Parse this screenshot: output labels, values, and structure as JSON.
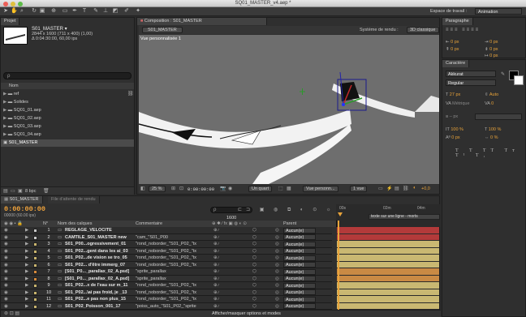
{
  "window": {
    "title": "SQ01_MASTER_v4.aep *"
  },
  "toolbar": {
    "workspace_label": "Espace de travail :",
    "workspace_value": "Animation"
  },
  "project": {
    "tab": "Projet",
    "item_name": "S01_MASTER ▾",
    "item_info1": "2844 x 1600  (711 x 400) (1,00)",
    "item_info2": "Δ 0:04:30:00, 60,00 ips",
    "search_placeholder": "ρ",
    "col_name": "Nom",
    "items": [
      "ref",
      "Solides",
      "SQ01_01.aep",
      "SQ01_02.aep",
      "SQ01_03.aep",
      "SQ01_04.aep",
      "S01_MASTER"
    ],
    "bpc": "8 bpc"
  },
  "composition": {
    "tab": "Composition : S01_MASTER",
    "comp_btn": "S01_MASTER",
    "renderer": "Système de rendu :",
    "renderer_value": "3D classique",
    "view_label": "Vue personnalisée 1",
    "zoom": "25 %",
    "time": "0:00:00:00",
    "quality": "Un quart",
    "view_select": "Vue personn...",
    "views": "1 vue",
    "exposure": "+0,0"
  },
  "paragraph": {
    "tab": "Paragraphe",
    "indent_values": [
      "0 px",
      "0 px",
      "0 px",
      "0 px",
      "0 px"
    ]
  },
  "character": {
    "tab": "Caractère",
    "font": "Akkurat",
    "style": "Regular",
    "size": "27 px",
    "leading": "Auto",
    "kerning": "Métrique",
    "tracking": "0",
    "stroke": "– px",
    "vscale": "100 %",
    "hscale": "100 %",
    "baseline": "0 px",
    "tsume": "0 %"
  },
  "timeline": {
    "tab": "S01_MASTER",
    "render_tab": "File d'attente de rendu",
    "timecode": "0:00:00:00",
    "frames": "00000 (60.00 ips)",
    "search_placeholder": "ρ",
    "frame_box": "1600",
    "col_num": "N°",
    "col_name": "Nom des calques",
    "col_comment": "Commentaire",
    "col_parent": "Parent",
    "ruler": [
      "00s",
      "02m",
      "04m"
    ],
    "marker_text": "texte sur une ligne - morts",
    "bottom_label": "Afficher/masquer options et modes",
    "layers": [
      {
        "num": "1",
        "name": "REGLAGE_VELOCITE",
        "comment": "",
        "parent": "Aucun(e)",
        "color": "#c8c8c8",
        "bar": "#b33a3a"
      },
      {
        "num": "2",
        "name": "CAMTILE_S01_MASTER new",
        "comment": "\"cam_\"S01_P00",
        "parent": "Aucun(e)",
        "color": "#c8c8c8",
        "bar": "#b33a3a"
      },
      {
        "num": "3",
        "name": "S01_P00...ogressivement_01",
        "comment": "\"rond_noborder_\"S01_P02_\"tx",
        "parent": "Aucun(e)",
        "color": "#c8b46e",
        "bar": "#c9b872"
      },
      {
        "num": "4",
        "name": "S01_P02...gent dans les ai_03",
        "comment": "\"rond_noborder_\"S01_P02_\"tx",
        "parent": "Aucun(e)",
        "color": "#c8b46e",
        "bar": "#c9b872"
      },
      {
        "num": "5",
        "name": "S01_P02...de vision se tro_05",
        "comment": "\"rond_noborder_\"S01_P02_\"tx",
        "parent": "Aucun(e)",
        "color": "#c8b46e",
        "bar": "#c9b872"
      },
      {
        "num": "6",
        "name": "S01_P02... d'être immerg_07",
        "comment": "\"rond_noborder_\"S01_P02_\"tx",
        "parent": "Aucun(e)",
        "color": "#c8b46e",
        "bar": "#c9b872"
      },
      {
        "num": "7",
        "name": "[S01_P0..._parallax_02_A.psd]",
        "comment": "\"sprite_parallax",
        "parent": "Aucun(e)",
        "color": "#d68a3c",
        "bar": "#c98a44"
      },
      {
        "num": "8",
        "name": "[S01_P0..._parallax_02_A.psd]",
        "comment": "\"sprite_parallax",
        "parent": "Aucun(e)",
        "color": "#d68a3c",
        "bar": "#c98a44"
      },
      {
        "num": "9",
        "name": "S01_P02...x de l'eau sur m_11",
        "comment": "\"rond_noborder_\"S01_P02_\"tx",
        "parent": "Aucun(e)",
        "color": "#c8b46e",
        "bar": "#c9b872"
      },
      {
        "num": "10",
        "name": "S01_P02...\\ai pas froid, je _13",
        "comment": "\"rond_noborder_\"S01_P02_\"tx",
        "parent": "Aucun(e)",
        "color": "#c8b46e",
        "bar": "#c9b872"
      },
      {
        "num": "11",
        "name": "S01_P02...e pas non plus_15",
        "comment": "\"rond_noborder_\"S01_P02_\"tx",
        "parent": "Aucun(e)",
        "color": "#c8b46e",
        "bar": "#c9b872"
      },
      {
        "num": "12",
        "name": "S01_P02_Poisson_001_17",
        "comment": "\"poiss_auto_\"S01_P02_\"sprite",
        "parent": "Aucun(e)",
        "color": "#c8b46e",
        "bar": "#c9b872"
      }
    ]
  }
}
